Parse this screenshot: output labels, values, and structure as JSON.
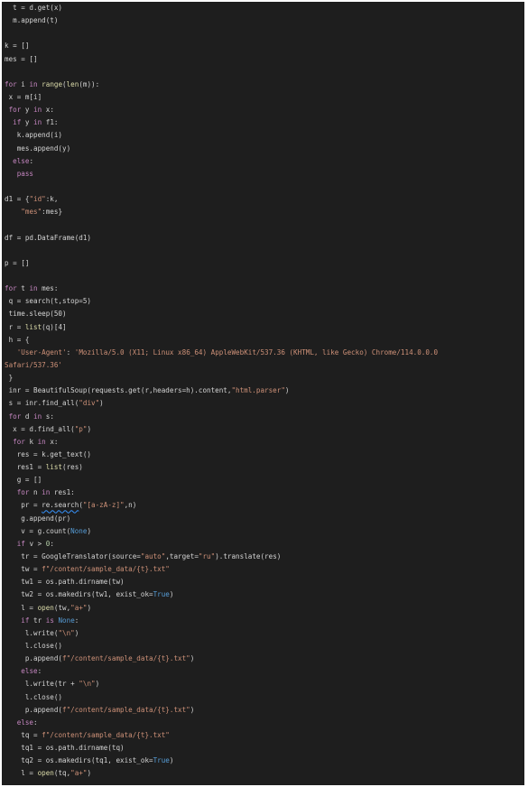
{
  "editor": {
    "theme": {
      "background": "#1e1e1e",
      "text": "#d4d4d4",
      "keyword": "#c586c0",
      "builtin": "#dcdcaa",
      "string": "#ce9178",
      "number": "#b5cea8",
      "constant": "#569cd6"
    },
    "lines": [
      [
        {
          "t": "  t = d.get(x)",
          "c": "id"
        }
      ],
      [
        {
          "t": "  m.append(t)",
          "c": "id"
        }
      ],
      [],
      [
        {
          "t": "k = []",
          "c": "id"
        }
      ],
      [
        {
          "t": "mes = []",
          "c": "id"
        }
      ],
      [],
      [
        {
          "t": "for",
          "c": "kw"
        },
        {
          "t": " i ",
          "c": "id"
        },
        {
          "t": "in",
          "c": "kw"
        },
        {
          "t": " ",
          "c": "id"
        },
        {
          "t": "range",
          "c": "bi"
        },
        {
          "t": "(",
          "c": "id"
        },
        {
          "t": "len",
          "c": "bi"
        },
        {
          "t": "(m)):",
          "c": "id"
        }
      ],
      [
        {
          "t": " x = m[i]",
          "c": "id"
        }
      ],
      [
        {
          "t": " ",
          "c": "id"
        },
        {
          "t": "for",
          "c": "kw"
        },
        {
          "t": " y ",
          "c": "id"
        },
        {
          "t": "in",
          "c": "kw"
        },
        {
          "t": " x:",
          "c": "id"
        }
      ],
      [
        {
          "t": "  ",
          "c": "id"
        },
        {
          "t": "if",
          "c": "kw"
        },
        {
          "t": " y ",
          "c": "id"
        },
        {
          "t": "in",
          "c": "kw"
        },
        {
          "t": " f1:",
          "c": "id"
        }
      ],
      [
        {
          "t": "   k.append(i)",
          "c": "id"
        }
      ],
      [
        {
          "t": "   mes.append(y)",
          "c": "id"
        }
      ],
      [
        {
          "t": "  ",
          "c": "id"
        },
        {
          "t": "else",
          "c": "kw"
        },
        {
          "t": ":",
          "c": "id"
        }
      ],
      [
        {
          "t": "   ",
          "c": "id"
        },
        {
          "t": "pass",
          "c": "kw"
        }
      ],
      [],
      [
        {
          "t": "d1 = {",
          "c": "id"
        },
        {
          "t": "\"id\"",
          "c": "str"
        },
        {
          "t": ":k,",
          "c": "id"
        }
      ],
      [
        {
          "t": "    ",
          "c": "id"
        },
        {
          "t": "\"mes\"",
          "c": "str"
        },
        {
          "t": ":mes}",
          "c": "id"
        }
      ],
      [],
      [
        {
          "t": "df = pd.DataFrame(d1)",
          "c": "id"
        }
      ],
      [],
      [
        {
          "t": "p = []",
          "c": "id"
        }
      ],
      [],
      [
        {
          "t": "for",
          "c": "kw"
        },
        {
          "t": " t ",
          "c": "id"
        },
        {
          "t": "in",
          "c": "kw"
        },
        {
          "t": " mes:",
          "c": "id"
        }
      ],
      [
        {
          "t": " q = search(t,stop=5)",
          "c": "id"
        }
      ],
      [
        {
          "t": " time.sleep(50)",
          "c": "id"
        }
      ],
      [
        {
          "t": " r = ",
          "c": "id"
        },
        {
          "t": "list",
          "c": "bi"
        },
        {
          "t": "(q)[4]",
          "c": "id"
        }
      ],
      [
        {
          "t": " h = {",
          "c": "id"
        }
      ],
      [
        {
          "t": "   ",
          "c": "id"
        },
        {
          "t": "'User-Agent'",
          "c": "str"
        },
        {
          "t": ": ",
          "c": "id"
        },
        {
          "t": "'Mozilla/5.0 (X11; Linux x86_64) AppleWebKit/537.36 (KHTML, like Gecko) Chrome/114.0.0.0",
          "c": "str"
        }
      ],
      [
        {
          "t": "Safari/537.36'",
          "c": "str"
        }
      ],
      [
        {
          "t": " }",
          "c": "id"
        }
      ],
      [
        {
          "t": " inr = BeautifulSoup(requests.get(r,headers=h).content,",
          "c": "id"
        },
        {
          "t": "\"html.parser\"",
          "c": "str"
        },
        {
          "t": ")",
          "c": "id"
        }
      ],
      [
        {
          "t": " s = inr.find_all(",
          "c": "id"
        },
        {
          "t": "\"div\"",
          "c": "str"
        },
        {
          "t": ")",
          "c": "id"
        }
      ],
      [
        {
          "t": " ",
          "c": "id"
        },
        {
          "t": "for",
          "c": "kw"
        },
        {
          "t": " d ",
          "c": "id"
        },
        {
          "t": "in",
          "c": "kw"
        },
        {
          "t": " s:",
          "c": "id"
        }
      ],
      [
        {
          "t": "  x = d.find_all(",
          "c": "id"
        },
        {
          "t": "\"p\"",
          "c": "str"
        },
        {
          "t": ")",
          "c": "id"
        }
      ],
      [
        {
          "t": "  ",
          "c": "id"
        },
        {
          "t": "for",
          "c": "kw"
        },
        {
          "t": " k ",
          "c": "id"
        },
        {
          "t": "in",
          "c": "kw"
        },
        {
          "t": " x:",
          "c": "id"
        }
      ],
      [
        {
          "t": "   res = k.get_text()",
          "c": "id"
        }
      ],
      [
        {
          "t": "   res1 = ",
          "c": "id"
        },
        {
          "t": "list",
          "c": "bi"
        },
        {
          "t": "(res)",
          "c": "id"
        }
      ],
      [
        {
          "t": "   g = []",
          "c": "id"
        }
      ],
      [
        {
          "t": "   ",
          "c": "id"
        },
        {
          "t": "for",
          "c": "kw"
        },
        {
          "t": " n ",
          "c": "id"
        },
        {
          "t": "in",
          "c": "kw"
        },
        {
          "t": " res1:",
          "c": "id"
        }
      ],
      [
        {
          "t": "    pr = ",
          "c": "id"
        },
        {
          "t": "re.search",
          "c": "err"
        },
        {
          "t": "(",
          "c": "id"
        },
        {
          "t": "\"[a-zA-z]\"",
          "c": "str"
        },
        {
          "t": ",n)",
          "c": "id"
        }
      ],
      [
        {
          "t": "    g.append(pr)",
          "c": "id"
        }
      ],
      [
        {
          "t": "    v = g.count(",
          "c": "id"
        },
        {
          "t": "None",
          "c": "const"
        },
        {
          "t": ")",
          "c": "id"
        }
      ],
      [
        {
          "t": "   ",
          "c": "id"
        },
        {
          "t": "if",
          "c": "kw"
        },
        {
          "t": " v > ",
          "c": "id"
        },
        {
          "t": "0",
          "c": "num"
        },
        {
          "t": ":",
          "c": "id"
        }
      ],
      [
        {
          "t": "    tr = GoogleTranslator(source=",
          "c": "id"
        },
        {
          "t": "\"auto\"",
          "c": "str"
        },
        {
          "t": ",target=",
          "c": "id"
        },
        {
          "t": "\"ru\"",
          "c": "str"
        },
        {
          "t": ").translate(res)",
          "c": "id"
        }
      ],
      [
        {
          "t": "    tw = ",
          "c": "id"
        },
        {
          "t": "f\"/content/sample_data/{t}.txt\"",
          "c": "str"
        }
      ],
      [
        {
          "t": "    tw1 = os.path.dirname(tw)",
          "c": "id"
        }
      ],
      [
        {
          "t": "    tw2 = os.makedirs(tw1, exist_ok=",
          "c": "id"
        },
        {
          "t": "True",
          "c": "const"
        },
        {
          "t": ")",
          "c": "id"
        }
      ],
      [
        {
          "t": "    l = ",
          "c": "id"
        },
        {
          "t": "open",
          "c": "bi"
        },
        {
          "t": "(tw,",
          "c": "id"
        },
        {
          "t": "\"a+\"",
          "c": "str"
        },
        {
          "t": ")",
          "c": "id"
        }
      ],
      [
        {
          "t": "    ",
          "c": "id"
        },
        {
          "t": "if",
          "c": "kw"
        },
        {
          "t": " tr ",
          "c": "id"
        },
        {
          "t": "is",
          "c": "kw"
        },
        {
          "t": " ",
          "c": "id"
        },
        {
          "t": "None",
          "c": "const"
        },
        {
          "t": ":",
          "c": "id"
        }
      ],
      [
        {
          "t": "     l.write(",
          "c": "id"
        },
        {
          "t": "\"\\n\"",
          "c": "str"
        },
        {
          "t": ")",
          "c": "id"
        }
      ],
      [
        {
          "t": "     l.close()",
          "c": "id"
        }
      ],
      [
        {
          "t": "     p.append(",
          "c": "id"
        },
        {
          "t": "f\"/content/sample_data/{t}.txt\"",
          "c": "str"
        },
        {
          "t": ")",
          "c": "id"
        }
      ],
      [
        {
          "t": "    ",
          "c": "id"
        },
        {
          "t": "else",
          "c": "kw"
        },
        {
          "t": ":",
          "c": "id"
        }
      ],
      [
        {
          "t": "     l.write(tr + ",
          "c": "id"
        },
        {
          "t": "\"\\n\"",
          "c": "str"
        },
        {
          "t": ")",
          "c": "id"
        }
      ],
      [
        {
          "t": "     l.close()",
          "c": "id"
        }
      ],
      [
        {
          "t": "     p.append(",
          "c": "id"
        },
        {
          "t": "f\"/content/sample_data/{t}.txt\"",
          "c": "str"
        },
        {
          "t": ")",
          "c": "id"
        }
      ],
      [
        {
          "t": "   ",
          "c": "id"
        },
        {
          "t": "else",
          "c": "kw"
        },
        {
          "t": ":",
          "c": "id"
        }
      ],
      [
        {
          "t": "    tq = ",
          "c": "id"
        },
        {
          "t": "f\"/content/sample_data/{t}.txt\"",
          "c": "str"
        }
      ],
      [
        {
          "t": "    tq1 = os.path.dirname(tq)",
          "c": "id"
        }
      ],
      [
        {
          "t": "    tq2 = os.makedirs(tq1, exist_ok=",
          "c": "id"
        },
        {
          "t": "True",
          "c": "const"
        },
        {
          "t": ")",
          "c": "id"
        }
      ],
      [
        {
          "t": "    l = ",
          "c": "id"
        },
        {
          "t": "open",
          "c": "bi"
        },
        {
          "t": "(tq,",
          "c": "id"
        },
        {
          "t": "\"a+\"",
          "c": "str"
        },
        {
          "t": ")",
          "c": "id"
        }
      ]
    ]
  }
}
